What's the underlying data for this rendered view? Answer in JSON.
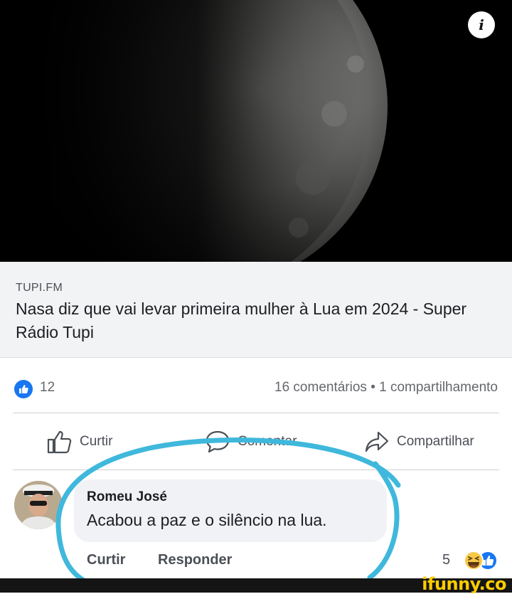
{
  "post": {
    "info_icon": "i",
    "link_source": "TUPI.FM",
    "link_title": "Nasa diz que vai levar primeira mulher à Lua em 2024 - Super Rádio Tupi"
  },
  "stats": {
    "likes": "12",
    "summary": "16 comentários • 1 compartilhamento"
  },
  "actions": {
    "like": "Curtir",
    "comment": "Comentar",
    "share": "Compartilhar"
  },
  "comment": {
    "author": "Romeu José",
    "text": "Acabou a paz e o silêncio na lua.",
    "like": "Curtir",
    "reply": "Responder",
    "reaction_count": "5"
  },
  "watermark": "ifunny.co",
  "colors": {
    "facebook_blue": "#1877f2",
    "annotation_circle": "#3fb8dc",
    "watermark_yellow": "#ffcc00"
  },
  "icons": [
    "info-icon",
    "like-reaction-icon",
    "thumbs-up-icon",
    "comment-icon",
    "share-icon",
    "haha-emoji-icon"
  ]
}
